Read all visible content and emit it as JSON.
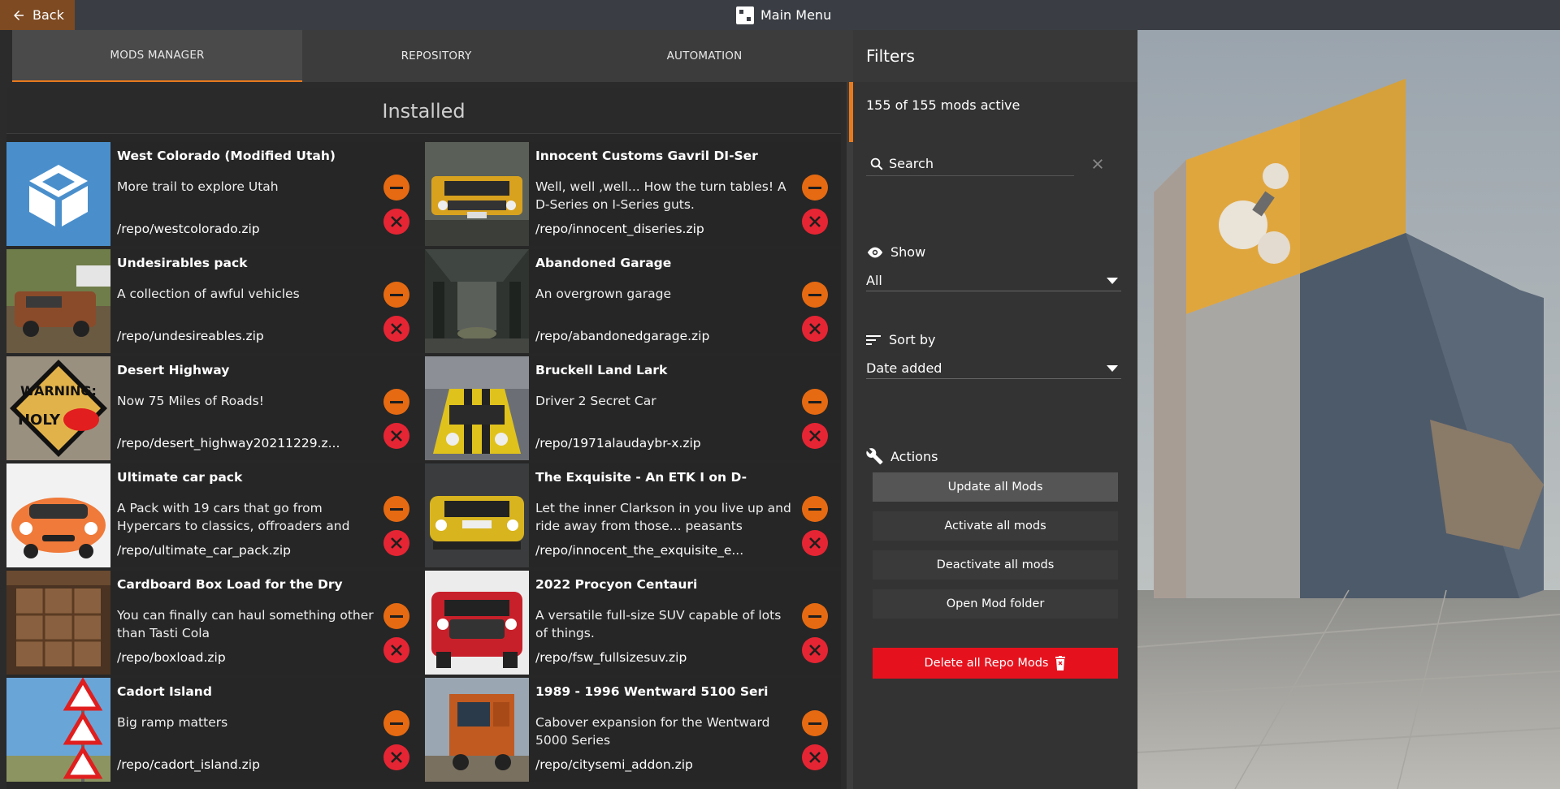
{
  "topbar": {
    "back_label": "Back",
    "title": "Main Menu"
  },
  "tabs": [
    {
      "label": "MODS MANAGER",
      "active": true
    },
    {
      "label": "REPOSITORY",
      "active": false
    },
    {
      "label": "AUTOMATION",
      "active": false
    }
  ],
  "installed": {
    "header": "Installed",
    "mods": [
      {
        "title": "West Colorado (Modified Utah)",
        "desc": "More trail to explore Utah",
        "path": "/repo/westcolorado.zip"
      },
      {
        "title": "Innocent Customs Gavril DI-Ser",
        "desc": "Well, well ,well... How the turn tables! A D-Series on I-Series guts.",
        "path": "/repo/innocent_diseries.zip"
      },
      {
        "title": "Undesirables pack",
        "desc": "A collection of awful vehicles",
        "path": "/repo/undesireables.zip"
      },
      {
        "title": "Abandoned Garage",
        "desc": "An overgrown garage",
        "path": "/repo/abandonedgarage.zip"
      },
      {
        "title": "Desert Highway",
        "desc": "Now 75 Miles of Roads!",
        "path": "/repo/desert_highway20211229.z..."
      },
      {
        "title": "Bruckell Land Lark",
        "desc": "Driver 2 Secret Car",
        "path": "/repo/1971alaudaybr-x.zip"
      },
      {
        "title": "Ultimate car pack",
        "desc": "A Pack with 19 cars that go from Hypercars to classics, offroaders and",
        "path": "/repo/ultimate_car_pack.zip"
      },
      {
        "title": "The Exquisite - An ETK I on D-",
        "desc": "Let the inner Clarkson in you live up and ride away from those... peasants",
        "path": "/repo/innocent_the_exquisite_e..."
      },
      {
        "title": "Cardboard Box Load for the Dry",
        "desc": "You can finally can haul something other than Tasti Cola",
        "path": "/repo/boxload.zip"
      },
      {
        "title": "2022 Procyon Centauri",
        "desc": "A versatile full-size SUV capable of lots of things.",
        "path": "/repo/fsw_fullsizesuv.zip"
      },
      {
        "title": "Cadort Island",
        "desc": "Big ramp matters",
        "path": "/repo/cadort_island.zip"
      },
      {
        "title": "1989 - 1996 Wentward 5100 Seri",
        "desc": "Cabover expansion for the Wentward 5000 Series",
        "path": "/repo/citysemi_addon.zip"
      }
    ]
  },
  "filters": {
    "header": "Filters",
    "mods_active": "155 of 155 mods active",
    "search_placeholder": "Search",
    "show_label": "Show",
    "show_value": "All",
    "sort_label": "Sort by",
    "sort_value": "Date added",
    "actions_label": "Actions",
    "actions": [
      "Update all Mods",
      "Activate all mods",
      "Deactivate all mods",
      "Open Mod folder"
    ],
    "delete_label": "Delete all Repo Mods"
  },
  "colors": {
    "accent_orange": "#e87a1e",
    "remove_red": "#e52533",
    "delete_red": "#e5121e",
    "back_brown": "#7d4a22"
  }
}
